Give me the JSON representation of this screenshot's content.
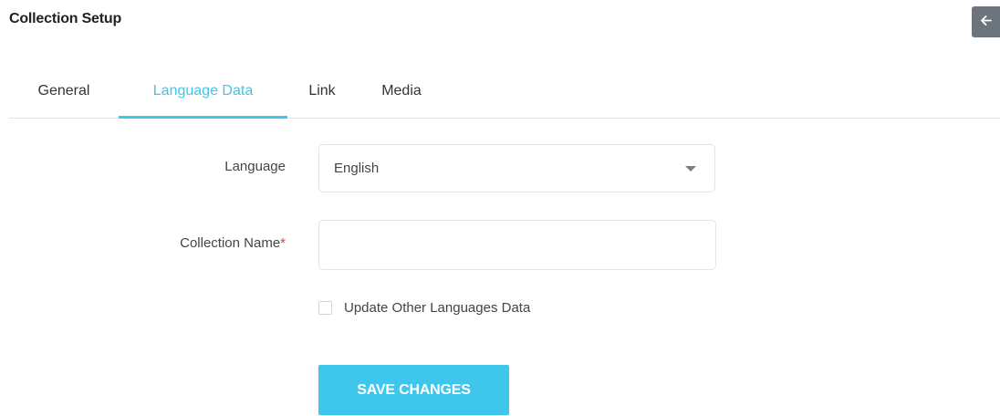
{
  "header": {
    "title": "Collection Setup",
    "back_icon": "arrow-left-icon"
  },
  "tabs": [
    {
      "label": "General",
      "active": false
    },
    {
      "label": "Language Data",
      "active": true
    },
    {
      "label": "Link",
      "active": false
    },
    {
      "label": "Media",
      "active": false
    }
  ],
  "form": {
    "language": {
      "label": "Language",
      "selected": "English"
    },
    "collection_name": {
      "label": "Collection Name",
      "required_mark": "*",
      "value": "",
      "placeholder": ""
    },
    "update_other_languages": {
      "label": "Update Other Languages Data",
      "checked": false
    },
    "save_label": "SAVE CHANGES"
  },
  "colors": {
    "accent": "#3ec6ec",
    "back_button_bg": "#6c757d",
    "required": "#e53935"
  }
}
